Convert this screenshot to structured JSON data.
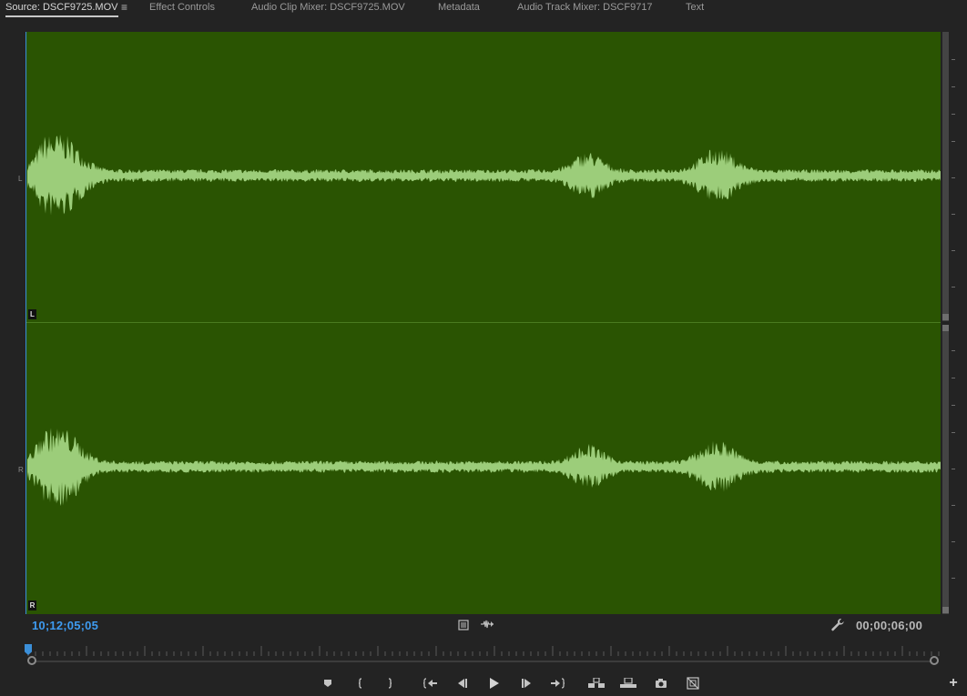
{
  "tabs": [
    {
      "label": "Source: DSCF9725.MOV",
      "active": true
    },
    {
      "label": "Effect Controls",
      "active": false
    },
    {
      "label": "Audio Clip Mixer: DSCF9725.MOV",
      "active": false
    },
    {
      "label": "Metadata",
      "active": false
    },
    {
      "label": "Audio Track Mixer: DSCF9717",
      "active": false
    },
    {
      "label": "Text",
      "active": false
    }
  ],
  "panel_menu_icon": "hamburger-menu-icon",
  "channels": {
    "left": {
      "side_label": "L",
      "tag_label": "L"
    },
    "right": {
      "side_label": "R",
      "tag_label": "R"
    }
  },
  "timecodes": {
    "current": "10;12;05;05",
    "duration": "00;00;06;00"
  },
  "icons": {
    "clip_icon": "clip-settings-icon",
    "drag_audio": "drag-audio-icon",
    "settings": "wrench-icon"
  },
  "transport": [
    {
      "name": "add-marker-button",
      "icon": "marker-icon"
    },
    {
      "name": "mark-in-button",
      "icon": "mark-in-icon"
    },
    {
      "name": "mark-out-button",
      "icon": "mark-out-icon"
    },
    {
      "name": "go-to-in-button",
      "icon": "go-to-in-icon"
    },
    {
      "name": "step-back-button",
      "icon": "step-back-icon"
    },
    {
      "name": "play-button",
      "icon": "play-icon"
    },
    {
      "name": "step-forward-button",
      "icon": "step-forward-icon"
    },
    {
      "name": "go-to-out-button",
      "icon": "go-to-out-icon"
    },
    {
      "name": "insert-button",
      "icon": "insert-icon"
    },
    {
      "name": "overwrite-button",
      "icon": "overwrite-icon"
    },
    {
      "name": "export-frame-button",
      "icon": "camera-icon"
    },
    {
      "name": "button-editor-button",
      "icon": "button-editor-icon"
    }
  ],
  "colors": {
    "waveform_bg": "#2a5402",
    "waveform": "#9ccd7a",
    "timecode_current": "#3e9bf0"
  }
}
